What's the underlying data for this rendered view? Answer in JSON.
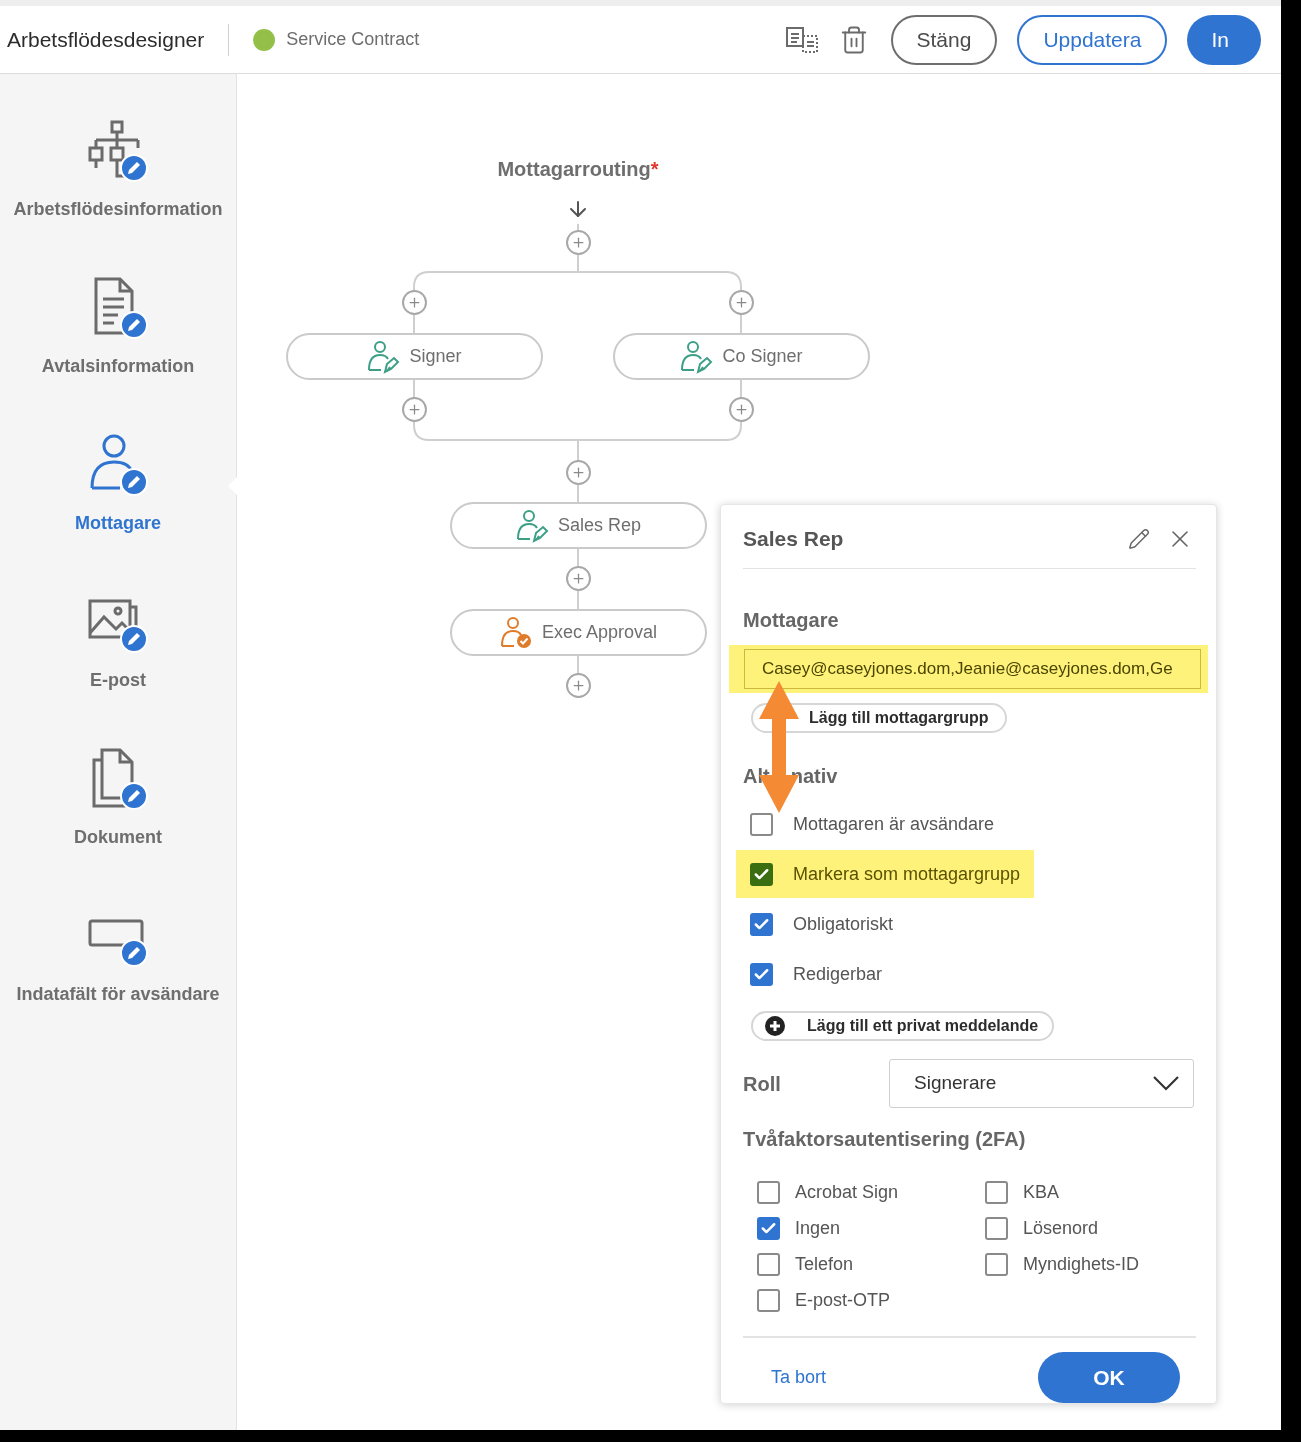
{
  "header": {
    "title": "Arbetsflödesdesigner",
    "workflow_name": "Service Contract",
    "buttons": [
      {
        "label": "Stäng",
        "kind": "secondary"
      },
      {
        "label": "Uppdatera",
        "kind": "outline"
      },
      {
        "label": "In",
        "kind": "primary"
      }
    ]
  },
  "sidebar": {
    "items": [
      {
        "label": "Arbetsflödesinformation",
        "selected": false
      },
      {
        "label": "Avtalsinformation",
        "selected": false
      },
      {
        "label": "Mottagare",
        "selected": true
      },
      {
        "label": "E-post",
        "selected": false
      },
      {
        "label": "Dokument",
        "selected": false
      },
      {
        "label": "Indatafält för avsändare",
        "selected": false
      }
    ]
  },
  "canvas": {
    "title": "Mottagarrouting",
    "required_mark": "*",
    "nodes": [
      {
        "label": "Signer",
        "kind": "signer"
      },
      {
        "label": "Co Signer",
        "kind": "signer"
      },
      {
        "label": "Sales Rep",
        "kind": "signer"
      },
      {
        "label": "Exec Approval",
        "kind": "approver"
      }
    ]
  },
  "panel": {
    "title": "Sales Rep",
    "recipients_label": "Mottagare",
    "recipients_value": "Casey@caseyjones.dom,Jeanie@caseyjones.dom,Ge",
    "recipients_highlighted": true,
    "add_group_button": "Lägg till mottagargrupp",
    "options_heading": [
      "Alt",
      "nativ"
    ],
    "options": [
      {
        "label": "Mottagaren är avsändare",
        "checked": false,
        "highlighted": false
      },
      {
        "label": "Markera som mottagargrupp",
        "checked": true,
        "highlighted": true
      },
      {
        "label": "Obligatoriskt",
        "checked": true,
        "highlighted": false
      },
      {
        "label": "Redigerbar",
        "checked": true,
        "highlighted": false
      }
    ],
    "private_message_button": "Lägg till ett privat meddelande",
    "role_label": "Roll",
    "role_value": "Signerare",
    "twofa_heading": "Tvåfaktorsautentisering (2FA)",
    "twofa_options": [
      {
        "label": "Acrobat Sign",
        "checked": false
      },
      {
        "label": "KBA",
        "checked": false
      },
      {
        "label": "Ingen",
        "checked": true
      },
      {
        "label": "Lösenord",
        "checked": false
      },
      {
        "label": "Telefon",
        "checked": false
      },
      {
        "label": "Myndighets-ID",
        "checked": false
      },
      {
        "label": "E-post-OTP",
        "checked": false
      }
    ],
    "delete_link": "Ta bort",
    "ok_button": "OK"
  }
}
